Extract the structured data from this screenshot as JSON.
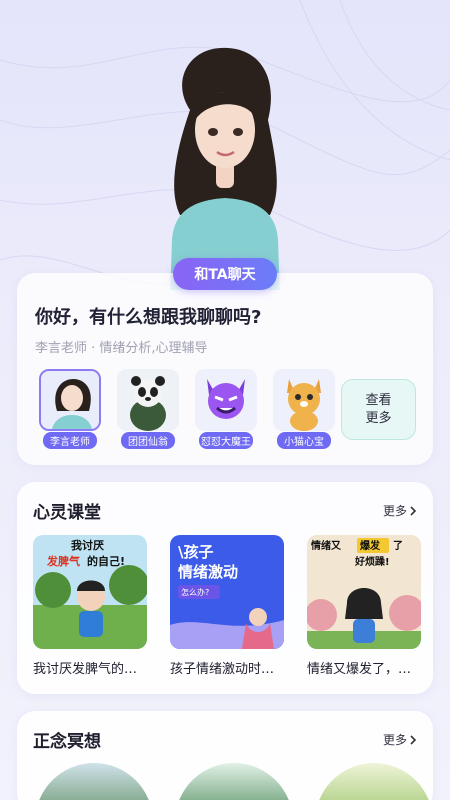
{
  "hero": {
    "chat_button": "和TA聊天"
  },
  "chat_card": {
    "greeting": "你好，有什么想跟我聊聊吗?",
    "subtitle": "李言老师 · 情绪分析,心理辅导",
    "characters": [
      {
        "name": "李言老师",
        "icon": "teacher-avatar",
        "selected": true
      },
      {
        "name": "团团仙翁",
        "icon": "panda-avatar",
        "selected": false
      },
      {
        "name": "怼怼大魔王",
        "icon": "devil-avatar",
        "selected": false
      },
      {
        "name": "小猫心宝",
        "icon": "cat-avatar",
        "selected": false
      }
    ],
    "more_line1": "查看",
    "more_line2": "更多"
  },
  "course_section": {
    "title": "心灵课堂",
    "more": "更多",
    "items": [
      {
        "title": "我讨厌发脾气的…",
        "thumb_text1": "我讨厌",
        "thumb_text2": "发脾气",
        "thumb_text3": "的自己!"
      },
      {
        "title": "孩子情绪激动时…",
        "thumb_text1": "\\孩子",
        "thumb_text2": "情绪激动",
        "thumb_text3": "怎么办?"
      },
      {
        "title": "情绪又爆发了，…",
        "thumb_text1": "情绪又",
        "thumb_text2": "爆发",
        "thumb_text3": "了",
        "thumb_text4": "好烦躁!"
      }
    ]
  },
  "meditation_section": {
    "title": "正念冥想",
    "more": "更多"
  },
  "colors": {
    "accent": "#6f6af3",
    "pill_start": "#8a63f5",
    "pill_end": "#6b7df8",
    "more_box_bg": "#e6f7f5"
  }
}
